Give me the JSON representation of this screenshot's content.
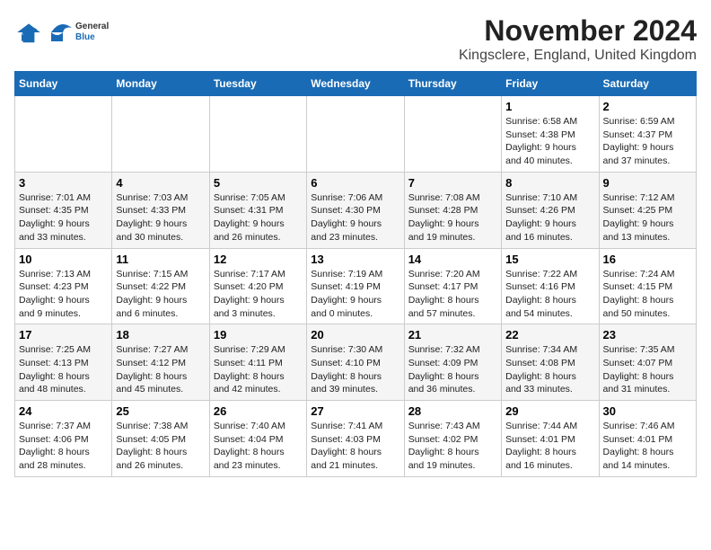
{
  "header": {
    "logo_general": "General",
    "logo_blue": "Blue",
    "month_title": "November 2024",
    "location": "Kingsclere, England, United Kingdom"
  },
  "weekdays": [
    "Sunday",
    "Monday",
    "Tuesday",
    "Wednesday",
    "Thursday",
    "Friday",
    "Saturday"
  ],
  "weeks": [
    [
      {
        "day": "",
        "info": ""
      },
      {
        "day": "",
        "info": ""
      },
      {
        "day": "",
        "info": ""
      },
      {
        "day": "",
        "info": ""
      },
      {
        "day": "",
        "info": ""
      },
      {
        "day": "1",
        "info": "Sunrise: 6:58 AM\nSunset: 4:38 PM\nDaylight: 9 hours\nand 40 minutes."
      },
      {
        "day": "2",
        "info": "Sunrise: 6:59 AM\nSunset: 4:37 PM\nDaylight: 9 hours\nand 37 minutes."
      }
    ],
    [
      {
        "day": "3",
        "info": "Sunrise: 7:01 AM\nSunset: 4:35 PM\nDaylight: 9 hours\nand 33 minutes."
      },
      {
        "day": "4",
        "info": "Sunrise: 7:03 AM\nSunset: 4:33 PM\nDaylight: 9 hours\nand 30 minutes."
      },
      {
        "day": "5",
        "info": "Sunrise: 7:05 AM\nSunset: 4:31 PM\nDaylight: 9 hours\nand 26 minutes."
      },
      {
        "day": "6",
        "info": "Sunrise: 7:06 AM\nSunset: 4:30 PM\nDaylight: 9 hours\nand 23 minutes."
      },
      {
        "day": "7",
        "info": "Sunrise: 7:08 AM\nSunset: 4:28 PM\nDaylight: 9 hours\nand 19 minutes."
      },
      {
        "day": "8",
        "info": "Sunrise: 7:10 AM\nSunset: 4:26 PM\nDaylight: 9 hours\nand 16 minutes."
      },
      {
        "day": "9",
        "info": "Sunrise: 7:12 AM\nSunset: 4:25 PM\nDaylight: 9 hours\nand 13 minutes."
      }
    ],
    [
      {
        "day": "10",
        "info": "Sunrise: 7:13 AM\nSunset: 4:23 PM\nDaylight: 9 hours\nand 9 minutes."
      },
      {
        "day": "11",
        "info": "Sunrise: 7:15 AM\nSunset: 4:22 PM\nDaylight: 9 hours\nand 6 minutes."
      },
      {
        "day": "12",
        "info": "Sunrise: 7:17 AM\nSunset: 4:20 PM\nDaylight: 9 hours\nand 3 minutes."
      },
      {
        "day": "13",
        "info": "Sunrise: 7:19 AM\nSunset: 4:19 PM\nDaylight: 9 hours\nand 0 minutes."
      },
      {
        "day": "14",
        "info": "Sunrise: 7:20 AM\nSunset: 4:17 PM\nDaylight: 8 hours\nand 57 minutes."
      },
      {
        "day": "15",
        "info": "Sunrise: 7:22 AM\nSunset: 4:16 PM\nDaylight: 8 hours\nand 54 minutes."
      },
      {
        "day": "16",
        "info": "Sunrise: 7:24 AM\nSunset: 4:15 PM\nDaylight: 8 hours\nand 50 minutes."
      }
    ],
    [
      {
        "day": "17",
        "info": "Sunrise: 7:25 AM\nSunset: 4:13 PM\nDaylight: 8 hours\nand 48 minutes."
      },
      {
        "day": "18",
        "info": "Sunrise: 7:27 AM\nSunset: 4:12 PM\nDaylight: 8 hours\nand 45 minutes."
      },
      {
        "day": "19",
        "info": "Sunrise: 7:29 AM\nSunset: 4:11 PM\nDaylight: 8 hours\nand 42 minutes."
      },
      {
        "day": "20",
        "info": "Sunrise: 7:30 AM\nSunset: 4:10 PM\nDaylight: 8 hours\nand 39 minutes."
      },
      {
        "day": "21",
        "info": "Sunrise: 7:32 AM\nSunset: 4:09 PM\nDaylight: 8 hours\nand 36 minutes."
      },
      {
        "day": "22",
        "info": "Sunrise: 7:34 AM\nSunset: 4:08 PM\nDaylight: 8 hours\nand 33 minutes."
      },
      {
        "day": "23",
        "info": "Sunrise: 7:35 AM\nSunset: 4:07 PM\nDaylight: 8 hours\nand 31 minutes."
      }
    ],
    [
      {
        "day": "24",
        "info": "Sunrise: 7:37 AM\nSunset: 4:06 PM\nDaylight: 8 hours\nand 28 minutes."
      },
      {
        "day": "25",
        "info": "Sunrise: 7:38 AM\nSunset: 4:05 PM\nDaylight: 8 hours\nand 26 minutes."
      },
      {
        "day": "26",
        "info": "Sunrise: 7:40 AM\nSunset: 4:04 PM\nDaylight: 8 hours\nand 23 minutes."
      },
      {
        "day": "27",
        "info": "Sunrise: 7:41 AM\nSunset: 4:03 PM\nDaylight: 8 hours\nand 21 minutes."
      },
      {
        "day": "28",
        "info": "Sunrise: 7:43 AM\nSunset: 4:02 PM\nDaylight: 8 hours\nand 19 minutes."
      },
      {
        "day": "29",
        "info": "Sunrise: 7:44 AM\nSunset: 4:01 PM\nDaylight: 8 hours\nand 16 minutes."
      },
      {
        "day": "30",
        "info": "Sunrise: 7:46 AM\nSunset: 4:01 PM\nDaylight: 8 hours\nand 14 minutes."
      }
    ]
  ]
}
